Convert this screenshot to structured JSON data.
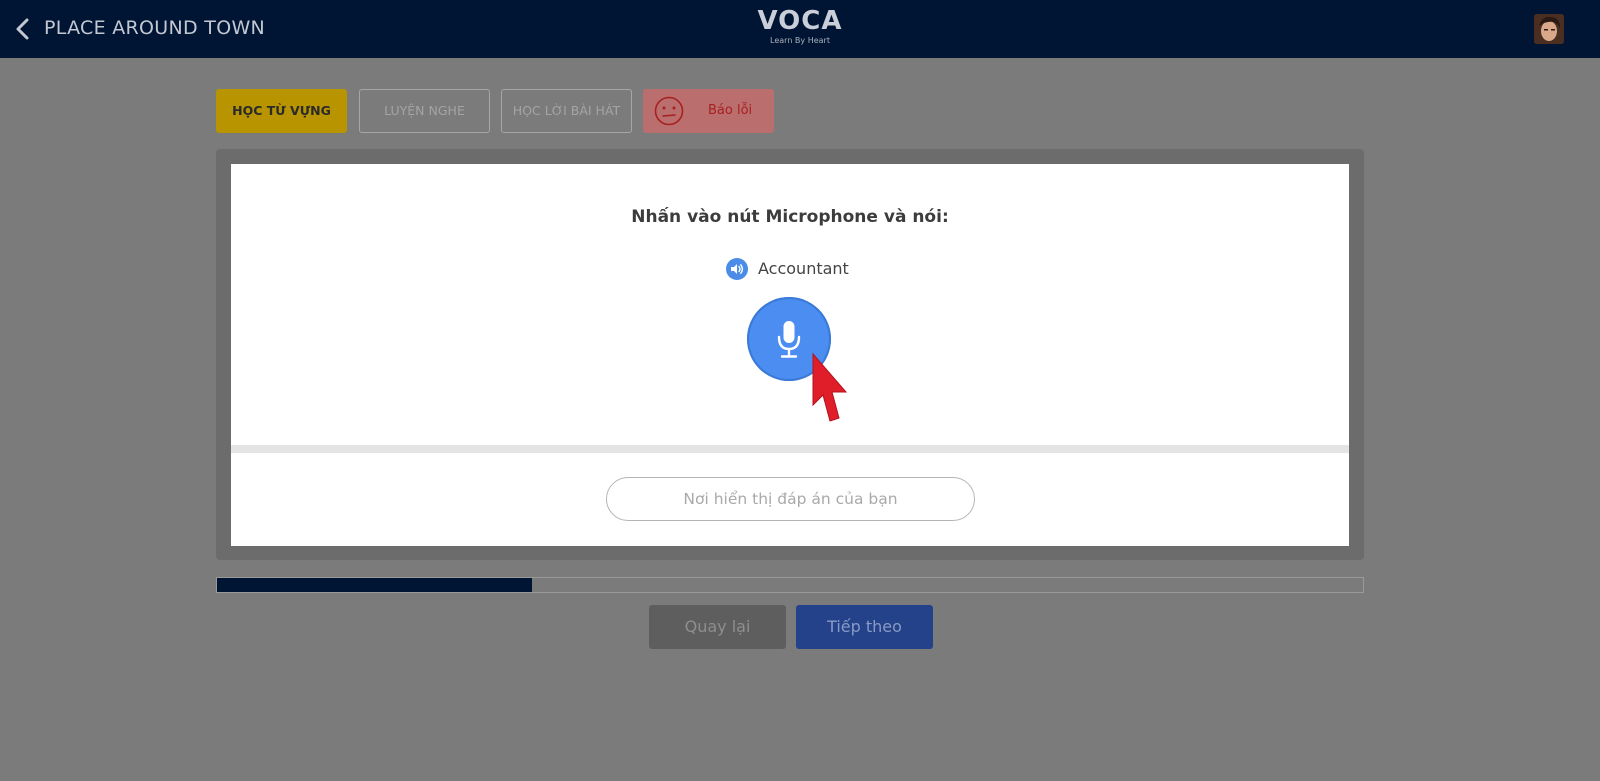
{
  "header": {
    "title": "PLACE AROUND TOWN",
    "logo": {
      "name": "VOCA",
      "tagline": "Learn By Heart"
    }
  },
  "tabs": {
    "vocab": "HỌC TỪ VỰNG",
    "listen": "LUYỆN NGHE",
    "lyrics": "HỌC LỜI BÀI HÁT",
    "report": "Báo lỗi"
  },
  "card": {
    "instruction": "Nhấn vào nút Microphone và nói:",
    "word": "Accountant",
    "answer_placeholder": "Nơi hiển thị đáp án của bạn"
  },
  "progress": {
    "fraction": 0.275
  },
  "nav": {
    "back": "Quay lại",
    "next": "Tiếp theo"
  },
  "colors": {
    "header_bg": "#001433",
    "accent_blue": "#4b8df0",
    "vocab_tab": "#b89400",
    "report_tab": "#bb6e6e",
    "cursor_red": "#e01e2a"
  },
  "icons": [
    "back-chevron-icon",
    "user-avatar",
    "confused-face-icon",
    "speaker-icon",
    "microphone-icon",
    "mouse-cursor-icon"
  ]
}
